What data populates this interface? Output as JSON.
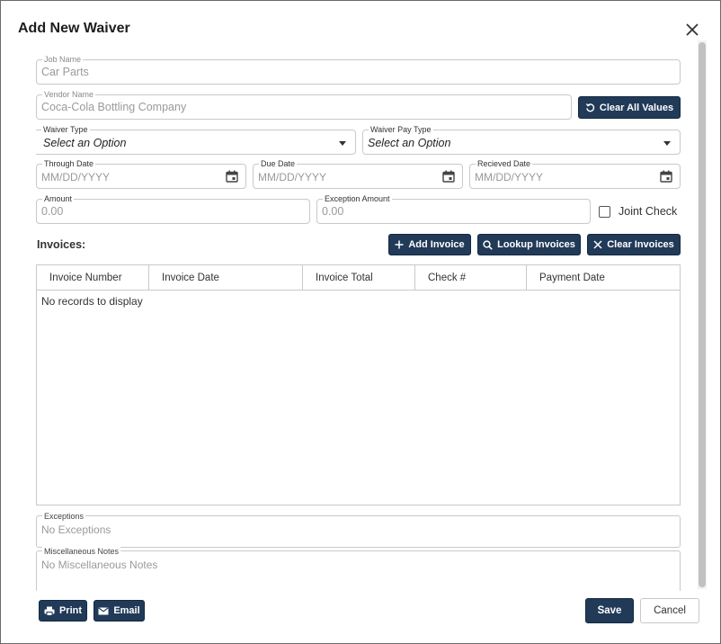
{
  "dialog": {
    "title": "Add New Waiver"
  },
  "form": {
    "job_name": {
      "label": "Job Name",
      "value": "Car Parts"
    },
    "vendor_name": {
      "label": "Vendor Name",
      "value": "Coca-Cola Bottling Company"
    },
    "clear_all_label": "Clear All Values",
    "waiver_type": {
      "label": "Waiver Type",
      "placeholder": "Select an Option"
    },
    "waiver_pay_type": {
      "label": "Waiver Pay Type",
      "placeholder": "Select an Option"
    },
    "through_date": {
      "label": "Through Date",
      "placeholder": "MM/DD/YYYY"
    },
    "due_date": {
      "label": "Due Date",
      "placeholder": "MM/DD/YYYY"
    },
    "received_date": {
      "label": "Recieved Date",
      "placeholder": "MM/DD/YYYY"
    },
    "amount": {
      "label": "Amount",
      "value": "0.00"
    },
    "exception_amount": {
      "label": "Exception Amount",
      "value": "0.00"
    },
    "joint_check_label": "Joint Check"
  },
  "invoices": {
    "label": "Invoices:",
    "add_label": "Add Invoice",
    "lookup_label": "Lookup Invoices",
    "clear_label": "Clear Invoices",
    "columns": [
      "Invoice Number",
      "Invoice Date",
      "Invoice Total",
      "Check #",
      "Payment Date"
    ],
    "empty_text": "No records to display"
  },
  "notes": {
    "exceptions": {
      "label": "Exceptions",
      "value": "No Exceptions"
    },
    "misc": {
      "label": "Miscellaneous Notes",
      "value": "No Miscellaneous Notes"
    }
  },
  "footer": {
    "print_label": "Print",
    "email_label": "Email",
    "save_label": "Save",
    "cancel_label": "Cancel"
  },
  "colors": {
    "primary": "#213a58",
    "required": "#d8262b"
  },
  "icons": [
    "close-icon",
    "undo-icon",
    "chevron-down-icon",
    "calendar-icon",
    "plus-icon",
    "search-icon",
    "x-icon",
    "printer-icon",
    "mail-icon"
  ]
}
